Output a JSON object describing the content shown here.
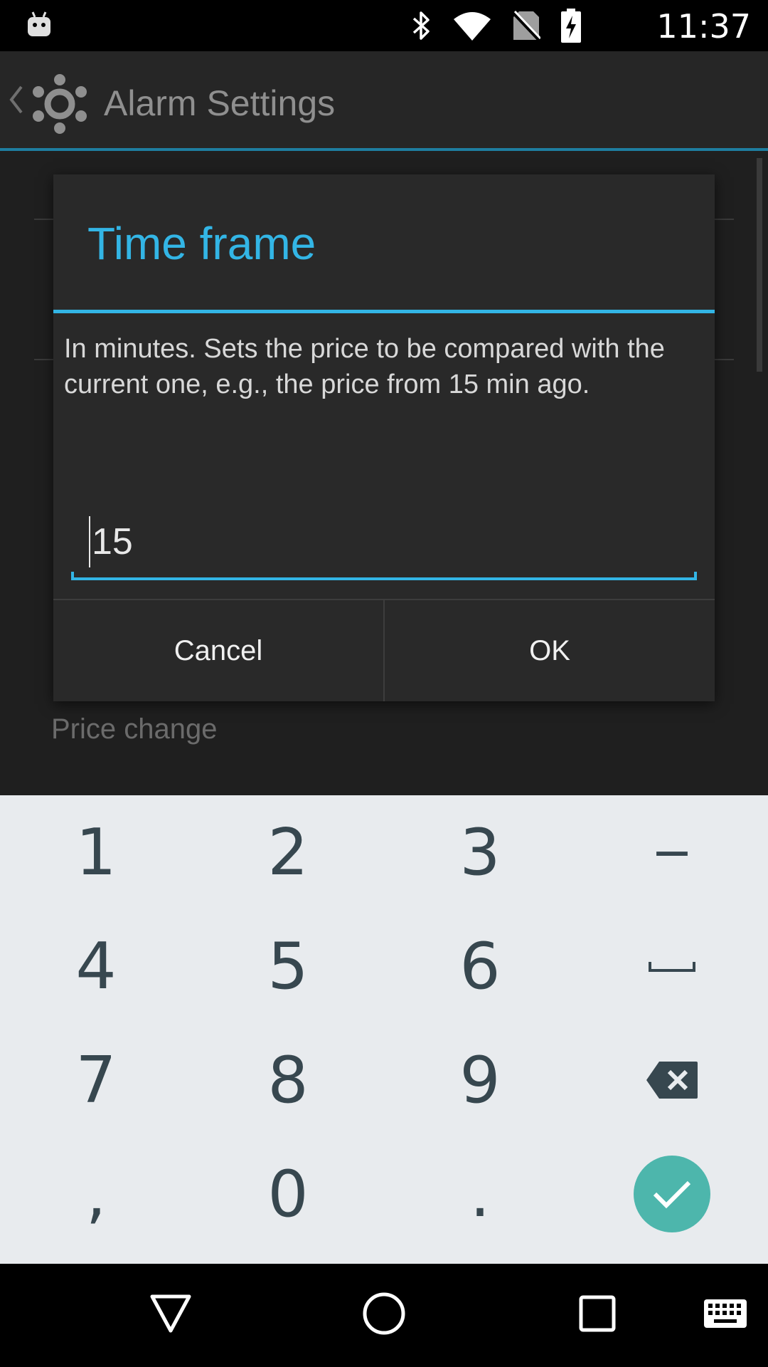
{
  "status_bar": {
    "time": "11:37",
    "icons": [
      "android-debug-icon",
      "bluetooth-icon",
      "wifi-icon",
      "no-sim-icon",
      "battery-charging-icon"
    ]
  },
  "app": {
    "title": "Alarm Settings",
    "background_item_label": "Price change"
  },
  "dialog": {
    "title": "Time frame",
    "message": "In minutes. Sets the price to be compared with the current one, e.g., the price from 15 min ago.",
    "input_value": "15",
    "cancel_label": "Cancel",
    "ok_label": "OK"
  },
  "keyboard": {
    "row1": [
      "1",
      "2",
      "3",
      "−"
    ],
    "row2": [
      "4",
      "5",
      "6"
    ],
    "row3": [
      "7",
      "8",
      "9"
    ],
    "row4": [
      ",",
      "0",
      "."
    ],
    "space_icon": "space-icon",
    "delete_icon": "backspace-icon",
    "enter_icon": "checkmark-icon"
  },
  "colors": {
    "accent": "#33b5e5",
    "enter_key": "#4db6ac",
    "key_text": "#37474f",
    "keyboard_bg": "#e8ebee"
  },
  "nav_bar": {
    "icons": [
      "back-icon",
      "home-icon",
      "recents-icon",
      "keyboard-switch-icon"
    ]
  }
}
